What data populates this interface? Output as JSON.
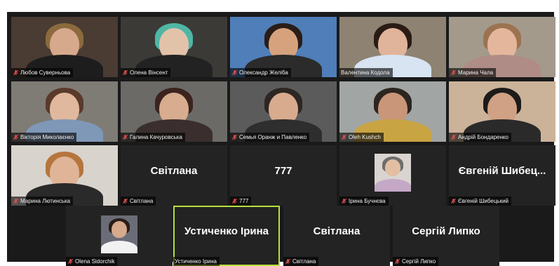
{
  "meeting": {
    "participants": [
      {
        "name": "Любов Суверньова",
        "muted": true,
        "bg": "#4a3b33",
        "skin": "#d7a98c",
        "hair": "#8b6a3e",
        "shirt": "#1d1d1d"
      },
      {
        "name": "Олена Вінсент",
        "muted": true,
        "bg": "#3b3a37",
        "skin": "#e3c2aa",
        "hair": "#4fb6a5",
        "shirt": "#222222"
      },
      {
        "name": "Олександр Желіба",
        "muted": true,
        "bg": "#4f7eb8",
        "skin": "#d6a27e",
        "hair": "#2a1d17",
        "shirt": "#2b2b2b"
      },
      {
        "name": "Валентина Кодола",
        "muted": false,
        "bg": "#8e8272",
        "skin": "#e0b49a",
        "hair": "#2a1b15",
        "shirt": "#d8e4f2"
      },
      {
        "name": "Марина Чала",
        "muted": true,
        "bg": "#a39a8c",
        "skin": "#e4b79c",
        "hair": "#9c7350",
        "shirt": "#b08c86"
      },
      {
        "name": "Вікторія Миколаєнко",
        "muted": true,
        "bg": "#7f7c75",
        "skin": "#e0b89d",
        "hair": "#5a3a2a",
        "shirt": "#7f98b7"
      },
      {
        "name": "Галина Качуровська",
        "muted": true,
        "bg": "#6b6a67",
        "skin": "#d7ac8f",
        "hair": "#3a241d",
        "shirt": "#3a2f2e"
      },
      {
        "name": "Семья Оранж и Павленко",
        "muted": true,
        "bg": "#5b5b5b",
        "skin": "#d8ab8f",
        "hair": "#2d2623",
        "shirt": "#2e2e2e"
      },
      {
        "name": "Oleh Kushch",
        "muted": true,
        "bg": "#a1a5a4",
        "skin": "#c99679",
        "hair": "#2c2520",
        "shirt": "#c8a443"
      },
      {
        "name": "Андрій Бондаренко",
        "muted": true,
        "bg": "#cbb39a",
        "skin": "#d0a184",
        "hair": "#1d1b19",
        "shirt": "#2a2a2a"
      },
      {
        "name": "Марина Лютинська",
        "muted": true,
        "bg": "#d8d3cc",
        "skin": "#e0b497",
        "hair": "#b6753c",
        "shirt": "#2a2a2a"
      },
      {
        "name": "Світлана",
        "muted": true,
        "display_name": "Світлана"
      },
      {
        "name": "777",
        "muted": true,
        "display_name": "777"
      },
      {
        "name": "Ірина Бучнєва",
        "muted": true,
        "photo": true,
        "bg": "#d9d4cf",
        "skin": "#e2bfa3",
        "hair": "#6d6d6d",
        "shirt": "#c5a8c6"
      },
      {
        "name": "Євгеній Шибецький",
        "muted": true,
        "display_name": "Євгеній Шибец..."
      },
      {
        "name": "Olena Sidorchik",
        "muted": true,
        "photo": true,
        "bg": "#6a6d77",
        "skin": "#d7a98d",
        "hair": "#2b1c17",
        "shirt": "#f2f2f2"
      },
      {
        "name": "Устиченко Ірина",
        "muted": false,
        "display_name": "Устиченко Ірина",
        "active": true
      },
      {
        "name": "Світлана",
        "muted": true,
        "display_name": "Світлана"
      },
      {
        "name": "Сергій Липко",
        "muted": true,
        "display_name": "Сергій Липко"
      }
    ]
  },
  "colors": {
    "stage": "#1a1a1a",
    "tile": "#232323",
    "muted_icon": "#e05050",
    "active_speaker": "#b6e03a"
  },
  "icons": {
    "muted": "mic-off-icon"
  }
}
